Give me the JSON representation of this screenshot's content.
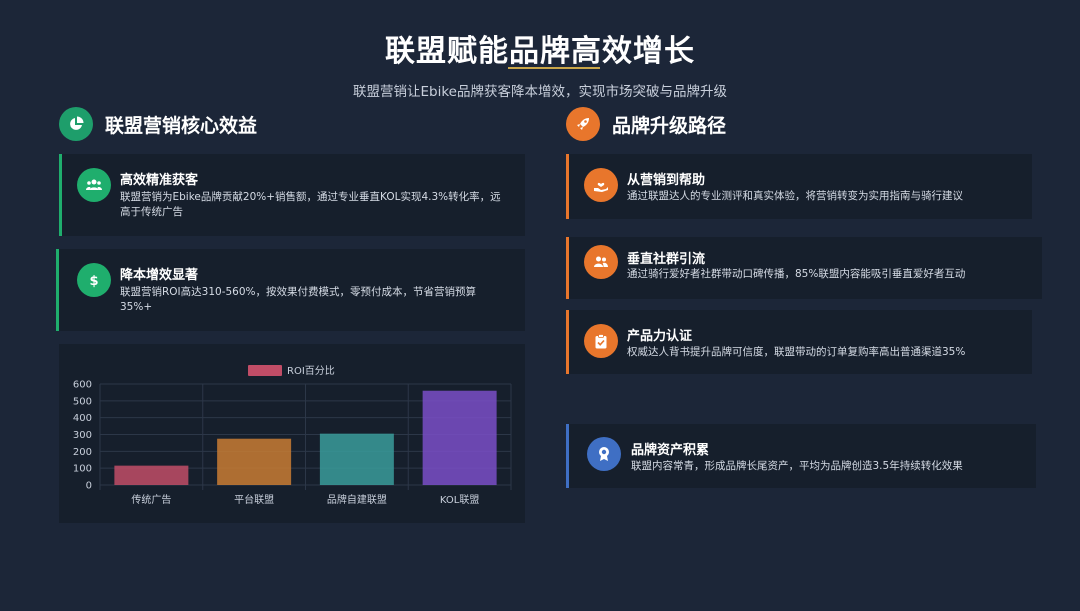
{
  "header": {
    "title": "联盟赋能品牌高效增长",
    "subtitle": "联盟营销让Ebike品牌获客降本增效，实现市场突破与品牌升级"
  },
  "left_section": {
    "title": "联盟营销核心效益",
    "icon": "pie-chart-icon",
    "icon_color": "#1e9e6b",
    "cards": [
      {
        "title": "高效精准获客",
        "desc": "联盟营销为Ebike品牌贡献20%+销售额，通过专业垂直KOL实现4.3%转化率，远高于传统广告",
        "icon": "users-icon",
        "accent": "#1fae6d"
      },
      {
        "title": "降本增效显著",
        "desc": "联盟营销ROI高达310-560%，按效果付费模式，零预付成本，节省营销预算35%+",
        "icon": "dollar-icon",
        "accent": "#1fae6d"
      }
    ]
  },
  "right_section": {
    "title": "品牌升级路径",
    "icon": "rocket-icon",
    "icon_color": "#e8762c",
    "cards": [
      {
        "title": "从营销到帮助",
        "desc": "通过联盟达人的专业测评和真实体验，将营销转变为实用指南与骑行建议",
        "icon": "helping-hand-icon",
        "accent": "#e8762c"
      },
      {
        "title": "垂直社群引流",
        "desc": "通过骑行爱好者社群带动口碑传播，85%联盟内容能吸引垂直爱好者互动",
        "icon": "community-icon",
        "accent": "#e8762c"
      },
      {
        "title": "产品力认证",
        "desc": "权威达人背书提升品牌可信度，联盟带动的订单复购率高出普通渠道35%",
        "icon": "clipboard-check-icon",
        "accent": "#e8762c"
      },
      {
        "title": "品牌资产积累",
        "desc": "联盟内容常青，形成品牌长尾资产，平均为品牌创造3.5年持续转化效果",
        "icon": "award-icon",
        "accent": "#3f6fc4"
      }
    ]
  },
  "chart_data": {
    "type": "bar",
    "categories": [
      "传统广告",
      "平台联盟",
      "品牌自建联盟",
      "KOL联盟"
    ],
    "series": [
      {
        "name": "ROI百分比",
        "values": [
          115,
          275,
          305,
          560
        ],
        "colors": [
          "#c14d67",
          "#c97d34",
          "#3a9c9b",
          "#7a4fc8"
        ]
      }
    ],
    "yticks": [
      "0",
      "100",
      "200",
      "300",
      "400",
      "500",
      "600"
    ],
    "ylim": [
      0,
      600
    ],
    "legend_position": "top-center",
    "grid": true
  }
}
